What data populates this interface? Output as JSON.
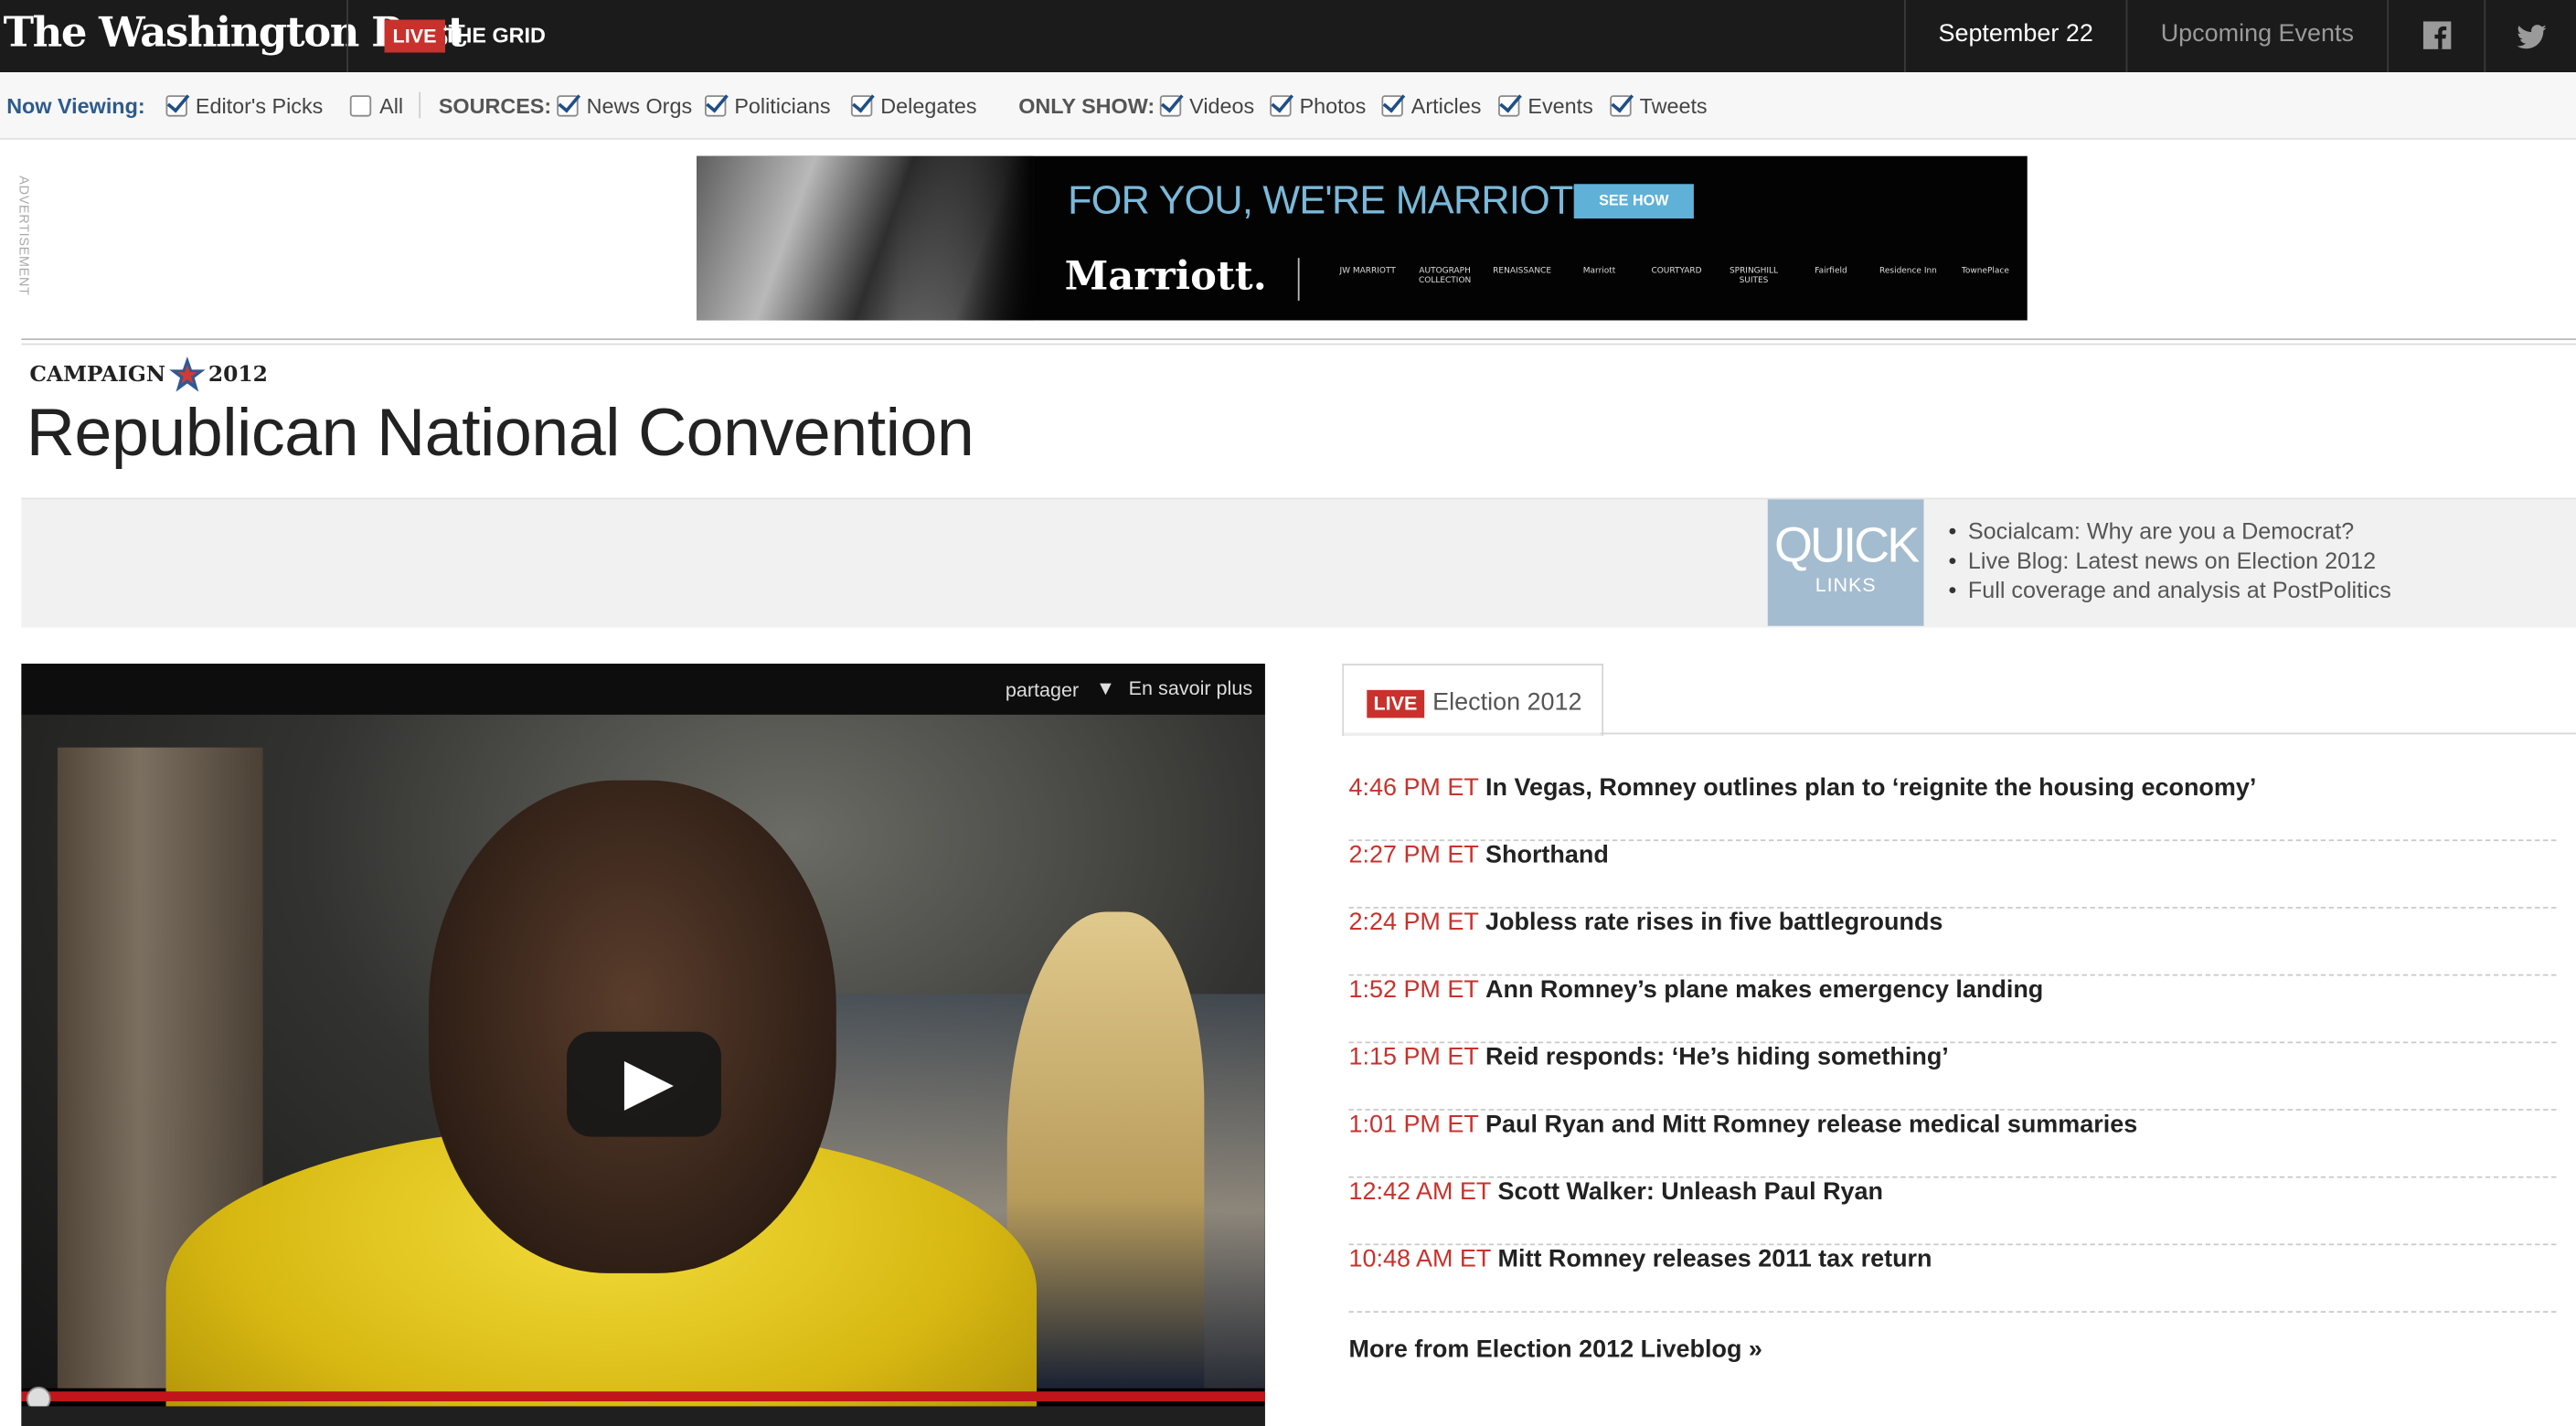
{
  "header": {
    "logo": "The Washington Post",
    "live_badge": "LIVE",
    "section": "THE GRID",
    "date": "September 22",
    "events_link": "Upcoming Events",
    "facebook_icon": "facebook-icon",
    "twitter_icon": "twitter-icon"
  },
  "filters": {
    "now_viewing_label": "Now Viewing:",
    "editors_picks": "Editor's Picks",
    "all": "All",
    "sources_label": "SOURCES:",
    "news_orgs": "News Orgs",
    "politicians": "Politicians",
    "delegates": "Delegates",
    "only_show_label": "ONLY SHOW:",
    "videos": "Videos",
    "photos": "Photos",
    "articles": "Articles",
    "events": "Events",
    "tweets": "Tweets"
  },
  "ad": {
    "label": "ADVERTISEMENT",
    "headline": "FOR YOU, WE'RE MARRIOTT.",
    "button": "SEE HOW",
    "logo": "Marriott.",
    "brands": [
      "JW MARRIOTT",
      "AUTOGRAPH COLLECTION",
      "RENAISSANCE",
      "Marriott",
      "COURTYARD",
      "SPRINGHILL SUITES",
      "Fairfield",
      "Residence Inn",
      "TownePlace"
    ]
  },
  "page": {
    "campaign_left": "CAMPAIGN",
    "campaign_right": "2012",
    "title": "Republican National Convention"
  },
  "quick_links": {
    "big": "QUICK",
    "small": "LINKS",
    "items": [
      "Socialcam: Why are you a Democrat?",
      "Live Blog: Latest news on Election 2012",
      "Full coverage and analysis at PostPolitics"
    ]
  },
  "video": {
    "share": "partager",
    "more": "En savoir plus"
  },
  "feed": {
    "live_badge": "LIVE",
    "name": "Election 2012",
    "items": [
      {
        "time": "4:46 PM ET",
        "headline": "In Vegas, Romney outlines plan to ‘reignite the housing economy’"
      },
      {
        "time": "2:27 PM ET",
        "headline": "Shorthand"
      },
      {
        "time": "2:24 PM ET",
        "headline": "Jobless rate rises in five battlegrounds"
      },
      {
        "time": "1:52 PM ET",
        "headline": "Ann Romney’s plane makes emergency landing"
      },
      {
        "time": "1:15 PM ET",
        "headline": "Reid responds: ‘He’s hiding something’"
      },
      {
        "time": "1:01 PM ET",
        "headline": "Paul Ryan and Mitt Romney release medical summaries"
      },
      {
        "time": "12:42 AM ET",
        "headline": "Scott Walker: Unleash Paul Ryan"
      },
      {
        "time": "10:48 AM ET",
        "headline": "Mitt Romney releases 2011 tax return"
      }
    ],
    "more": "More from Election 2012 Liveblog »"
  }
}
